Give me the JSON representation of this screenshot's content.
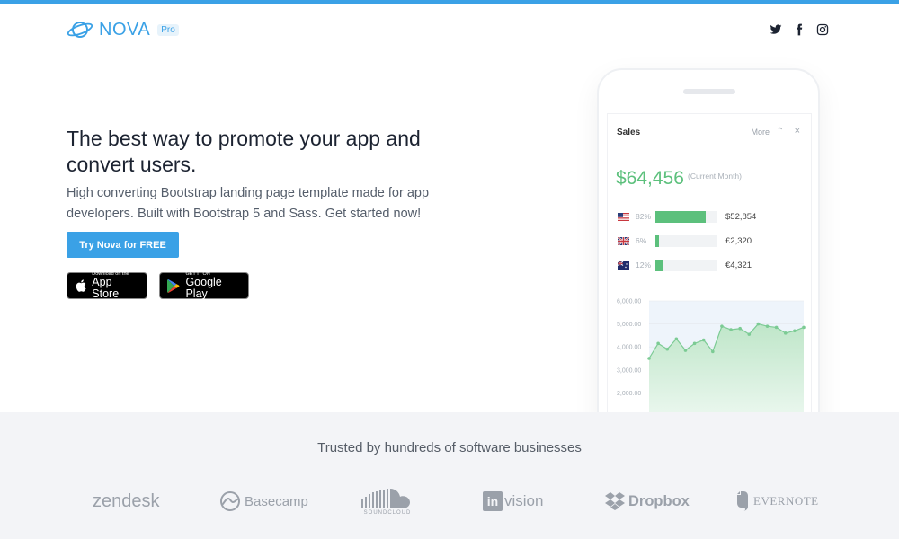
{
  "colors": {
    "accent": "#3aa1e6",
    "positive": "#5cc07c",
    "band": "#f3f4f7"
  },
  "brand": {
    "name": "NOVA",
    "badge": "Pro"
  },
  "social": [
    "twitter-icon",
    "facebook-icon",
    "instagram-icon"
  ],
  "hero": {
    "title": "The best way to promote your app and convert users.",
    "subtitle": "High converting Bootstrap landing page template made for app developers. Built with Bootstrap 5 and Sass. Get started now!",
    "cta_label": "Try Nova for FREE",
    "app_store": {
      "small": "Download on the",
      "big": "App Store"
    },
    "google_play": {
      "small": "GET IT ON",
      "big": "Google Play"
    }
  },
  "widget": {
    "title": "Sales",
    "more_label": "More",
    "amount": "$64,456",
    "amount_note": "(Current Month)",
    "rows": [
      {
        "flag": "us-flag-icon",
        "pct": "82%",
        "fraction": 0.82,
        "value": "$52,854"
      },
      {
        "flag": "uk-flag-icon",
        "pct": "6%",
        "fraction": 0.06,
        "value": "£2,320"
      },
      {
        "flag": "au-flag-icon",
        "pct": "12%",
        "fraction": 0.12,
        "value": "€4,321"
      }
    ]
  },
  "chart_data": {
    "type": "area",
    "title": "",
    "xlabel": "",
    "ylabel": "",
    "ylim": [
      1000,
      6000
    ],
    "yticks": [
      "6,000.00",
      "5,000.00",
      "4,000.00",
      "3,000.00",
      "2,000.00",
      "1,000.00"
    ],
    "grid": true,
    "series": [
      {
        "values": [
          3500,
          4150,
          3900,
          4350,
          3850,
          4150,
          4300,
          3800,
          4900,
          4750,
          4800,
          4550,
          5000,
          4900,
          4850,
          4600,
          4700,
          4850
        ]
      }
    ]
  },
  "trusted": {
    "title": "Trusted by hundreds of software businesses",
    "logos": [
      {
        "name": "zendesk",
        "icon": ""
      },
      {
        "name": "Basecamp",
        "icon": "basecamp-icon"
      },
      {
        "name": "SOUNDCLOUD",
        "icon": "soundcloud-icon"
      },
      {
        "name": "vision",
        "icon": "invision-icon",
        "prefix": "in"
      },
      {
        "name": "Dropbox",
        "icon": "dropbox-icon"
      },
      {
        "name": "EVERNOTE",
        "icon": "evernote-icon"
      }
    ]
  }
}
